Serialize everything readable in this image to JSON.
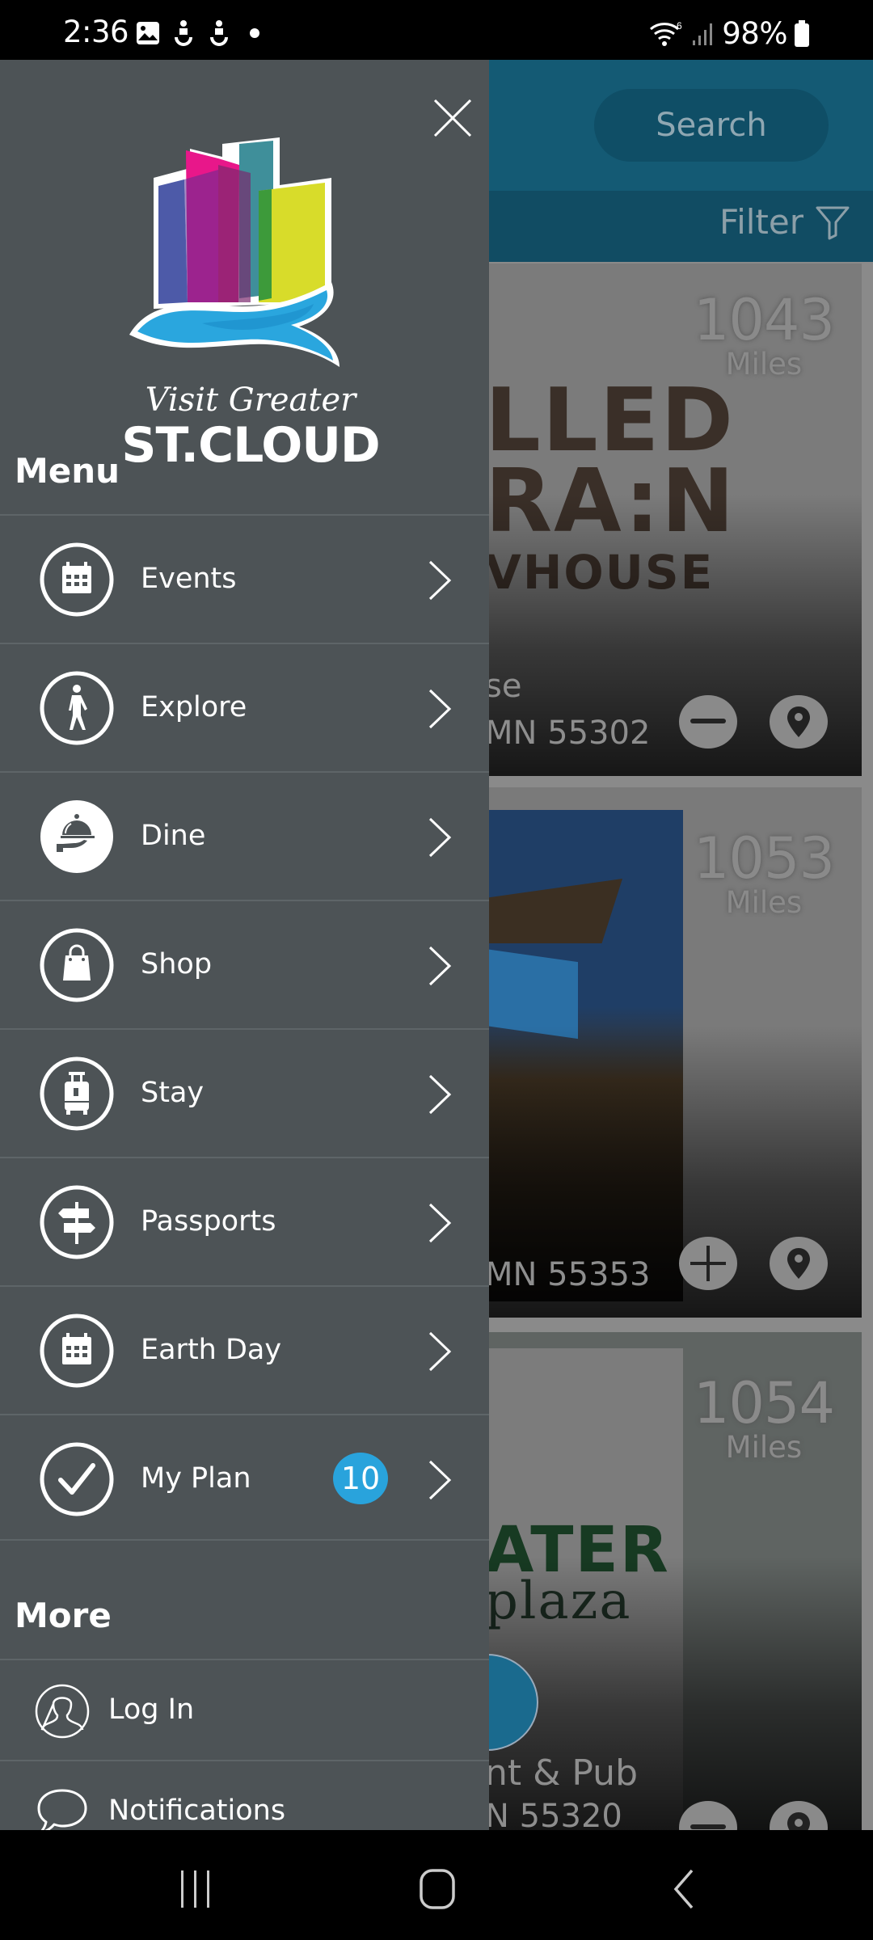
{
  "status_bar": {
    "time": "2:36",
    "left_icons": [
      "gallery-icon",
      "accessibility-icon",
      "accessibility-icon",
      "dot-icon"
    ],
    "right_icons": [
      "wifi-6-icon",
      "signal-icon",
      "battery-icon"
    ],
    "battery": "98%"
  },
  "background_app": {
    "search_placeholder": "Search",
    "filter_label": "Filter",
    "listings": [
      {
        "logo_line1": "LLED",
        "logo_line2": "RA:N",
        "logo_line3": "VHOUSE",
        "name_partial": "se",
        "address_partial": "MN 55302",
        "distance": "1043",
        "distance_unit": "Miles",
        "plan_action": "remove"
      },
      {
        "name_partial": "",
        "address_partial": "MN 55353",
        "distance": "1053",
        "distance_unit": "Miles",
        "plan_action": "add"
      },
      {
        "logo_line1": "ATER",
        "logo_line2": "plaza",
        "name_partial": "nt & Pub",
        "address_partial": "N 55320",
        "distance": "1054",
        "distance_unit": "Miles",
        "plan_action": "remove"
      }
    ]
  },
  "drawer": {
    "logo": {
      "line1": "Visit Greater",
      "line2": "ST.CLOUD"
    },
    "close_label": "Close",
    "menu_title": "Menu",
    "menu_items": [
      {
        "label": "Events",
        "icon": "calendar-icon"
      },
      {
        "label": "Explore",
        "icon": "walking-person-icon"
      },
      {
        "label": "Dine",
        "icon": "serving-cloche-icon"
      },
      {
        "label": "Shop",
        "icon": "shopping-bag-icon"
      },
      {
        "label": "Stay",
        "icon": "luggage-icon"
      },
      {
        "label": "Passports",
        "icon": "signpost-icon"
      },
      {
        "label": "Earth Day",
        "icon": "calendar-icon"
      },
      {
        "label": "My Plan",
        "icon": "checkmark-icon",
        "badge": "10"
      }
    ],
    "more_title": "More",
    "more_items": [
      {
        "label": "Log In",
        "icon": "user-icon"
      },
      {
        "label": "Notifications",
        "icon": "speech-bubble-icon"
      }
    ]
  },
  "colors": {
    "drawer_bg": "#4d5356",
    "badge": "#29a3dc",
    "header_blue": "#145a74"
  },
  "nav_bar": {
    "buttons": [
      "recent-apps",
      "home",
      "back"
    ]
  }
}
